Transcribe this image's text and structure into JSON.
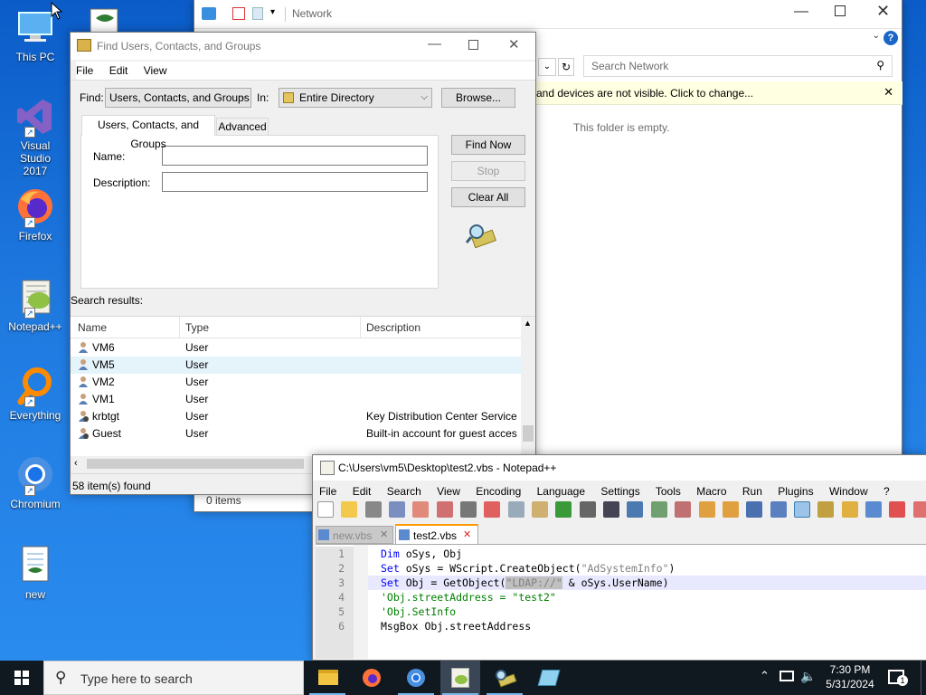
{
  "desktop": {
    "icons": [
      {
        "label": "This PC",
        "icon": "monitor-icon"
      },
      {
        "label": "Visual Studio 2017",
        "icon": "visual-studio-icon"
      },
      {
        "label": "Firefox",
        "icon": "firefox-icon"
      },
      {
        "label": "Notepad++",
        "icon": "notepadpp-icon"
      },
      {
        "label": "Everything",
        "icon": "everything-search-icon"
      },
      {
        "label": "Chromium",
        "icon": "chromium-icon"
      },
      {
        "label": "new",
        "icon": "vbs-script-icon"
      }
    ]
  },
  "explorer": {
    "title": "Network",
    "search_placeholder": "Search Network",
    "info_bar": "and devices are not visible. Click to change...",
    "empty_text": "This folder is empty.",
    "status": "0 items"
  },
  "find_dialog": {
    "title": "Find Users, Contacts, and Groups",
    "menu": [
      "File",
      "Edit",
      "View"
    ],
    "find_label": "Find:",
    "find_value": "Users, Contacts, and Groups",
    "in_label": "In:",
    "in_value": "Entire Directory",
    "browse": "Browse...",
    "tabs": [
      "Users, Contacts, and Groups",
      "Advanced"
    ],
    "name_label": "Name:",
    "description_label": "Description:",
    "find_now": "Find Now",
    "stop": "Stop",
    "clear_all": "Clear All",
    "results_label": "Search results:",
    "columns": [
      "Name",
      "Type",
      "Description"
    ],
    "rows": [
      {
        "name": "VM6",
        "type": "User",
        "description": ""
      },
      {
        "name": "VM5",
        "type": "User",
        "description": ""
      },
      {
        "name": "VM2",
        "type": "User",
        "description": ""
      },
      {
        "name": "VM1",
        "type": "User",
        "description": ""
      },
      {
        "name": "krbtgt",
        "type": "User",
        "description": "Key Distribution Center Service A"
      },
      {
        "name": "Guest",
        "type": "User",
        "description": "Built-in account for guest acces"
      }
    ],
    "status": "58 item(s) found"
  },
  "notepad": {
    "title": "C:\\Users\\vm5\\Desktop\\test2.vbs - Notepad++",
    "menu": [
      "File",
      "Edit",
      "Search",
      "View",
      "Encoding",
      "Language",
      "Settings",
      "Tools",
      "Macro",
      "Run",
      "Plugins",
      "Window",
      "?"
    ],
    "tabs": [
      "new.vbs",
      "test2.vbs"
    ],
    "line_numbers": [
      "1",
      "2",
      "3",
      "4",
      "5",
      "6"
    ],
    "code": {
      "l1_kw": "Dim",
      "l1_rest": " oSys, Obj",
      "l2_kw": "Set",
      "l2_rest": " oSys = WScript.CreateObject(",
      "l2_str": "\"AdSystemInfo\"",
      "l2_end": ")",
      "l3_kw": "Set",
      "l3_rest": " Obj = GetObject(",
      "l3_str": "\"LDAP://\"",
      "l3_end": " & oSys.UserName)",
      "l4": "'Obj.streetAddress = \"test2\"",
      "l5": "'Obj.SetInfo",
      "l6": "MsgBox Obj.streetAddress"
    }
  },
  "taskbar": {
    "search_placeholder": "Type here to search",
    "time": "7:30 PM",
    "date": "5/31/2024",
    "notifications": "1"
  }
}
